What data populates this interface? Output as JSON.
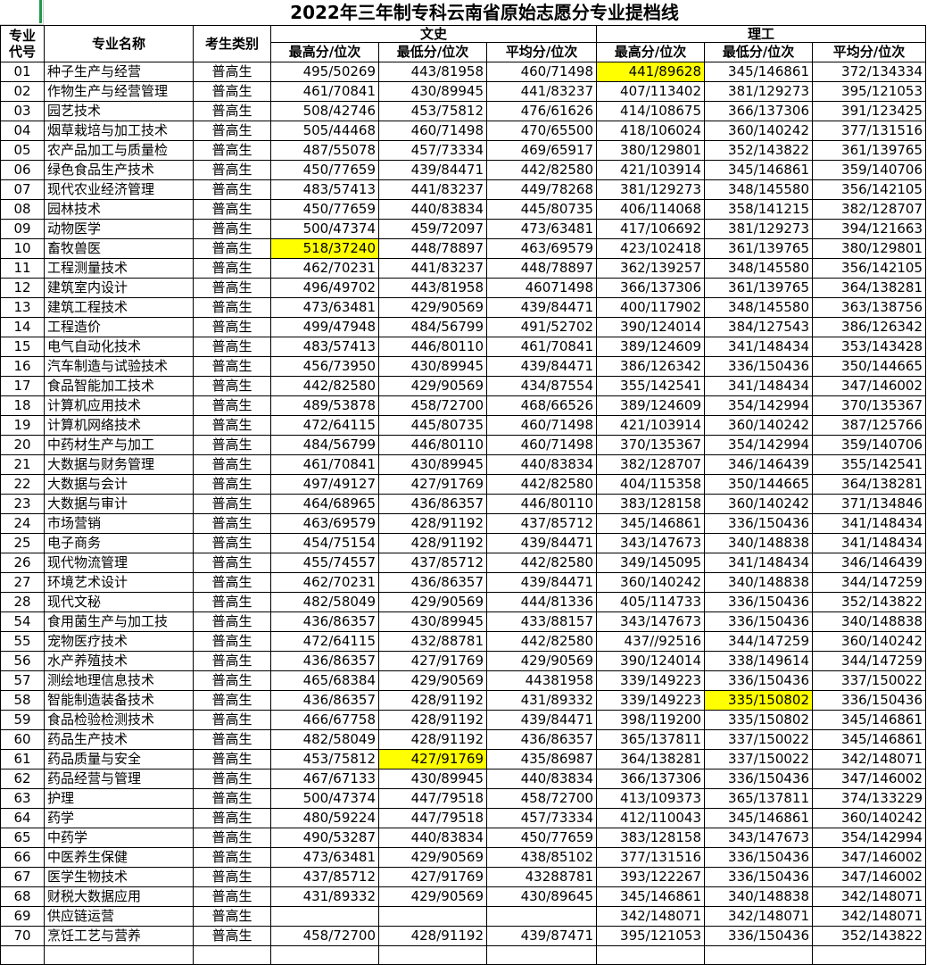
{
  "title": "2022年三年制专科云南省原始志愿分专业提档线",
  "headers": {
    "code": "专业代号",
    "name": "专业名称",
    "type": "考生类别",
    "wenshi": "文史",
    "ligong": "理工",
    "max": "最高分/位次",
    "min": "最低分/位次",
    "avg": "平均分/位次"
  },
  "highlight_color": "#ffff00",
  "rows": [
    {
      "code": "01",
      "name": "种子生产与经营",
      "type": "普高生",
      "w_max": "495/50269",
      "w_min": "443/81958",
      "w_avg": "460/71498",
      "l_max": "441/89628",
      "l_min": "345/146861",
      "l_avg": "372/134334",
      "hl": [
        "l_max"
      ]
    },
    {
      "code": "02",
      "name": "作物生产与经营管理",
      "type": "普高生",
      "w_max": "461/70841",
      "w_min": "430/89945",
      "w_avg": "441/83237",
      "l_max": "407/113402",
      "l_min": "381/129273",
      "l_avg": "395/121053",
      "hl": []
    },
    {
      "code": "03",
      "name": "园艺技术",
      "type": "普高生",
      "w_max": "508/42746",
      "w_min": "453/75812",
      "w_avg": "476/61626",
      "l_max": "414/108675",
      "l_min": "366/137306",
      "l_avg": "391/123425",
      "hl": []
    },
    {
      "code": "04",
      "name": "烟草栽培与加工技术",
      "type": "普高生",
      "w_max": "505/44468",
      "w_min": "460/71498",
      "w_avg": "470/65500",
      "l_max": "418/106024",
      "l_min": "360/140242",
      "l_avg": "377/131516",
      "hl": []
    },
    {
      "code": "05",
      "name": "农产品加工与质量检",
      "type": "普高生",
      "w_max": "487/55078",
      "w_min": "457/73334",
      "w_avg": "469/65917",
      "l_max": "380/129801",
      "l_min": "352/143822",
      "l_avg": "361/139765",
      "hl": []
    },
    {
      "code": "06",
      "name": "绿色食品生产技术",
      "type": "普高生",
      "w_max": "450/77659",
      "w_min": "439/84471",
      "w_avg": "442/82580",
      "l_max": "421/103914",
      "l_min": "345/146861",
      "l_avg": "359/140706",
      "hl": []
    },
    {
      "code": "07",
      "name": "现代农业经济管理",
      "type": "普高生",
      "w_max": "483/57413",
      "w_min": "441/83237",
      "w_avg": "449/78268",
      "l_max": "381/129273",
      "l_min": "348/145580",
      "l_avg": "356/142105",
      "hl": []
    },
    {
      "code": "08",
      "name": "园林技术",
      "type": "普高生",
      "w_max": "450/77659",
      "w_min": "440/83834",
      "w_avg": "445/80735",
      "l_max": "406/114068",
      "l_min": "358/141215",
      "l_avg": "382/128707",
      "hl": []
    },
    {
      "code": "09",
      "name": "动物医学",
      "type": "普高生",
      "w_max": "500/47374",
      "w_min": "459/72097",
      "w_avg": "473/63481",
      "l_max": "417/106692",
      "l_min": "381/129273",
      "l_avg": "394/121663",
      "hl": []
    },
    {
      "code": "10",
      "name": "畜牧兽医",
      "type": "普高生",
      "w_max": "518/37240",
      "w_min": "448/78897",
      "w_avg": "463/69579",
      "l_max": "423/102418",
      "l_min": "361/139765",
      "l_avg": "380/129801",
      "hl": [
        "w_max"
      ]
    },
    {
      "code": "11",
      "name": "工程测量技术",
      "type": "普高生",
      "w_max": "462/70231",
      "w_min": "441/83237",
      "w_avg": "448/78897",
      "l_max": "362/139257",
      "l_min": "348/145580",
      "l_avg": "356/142105",
      "hl": []
    },
    {
      "code": "12",
      "name": "建筑室内设计",
      "type": "普高生",
      "w_max": "496/49702",
      "w_min": "443/81958",
      "w_avg": "46071498",
      "l_max": "366/137306",
      "l_min": "361/139765",
      "l_avg": "364/138281",
      "hl": []
    },
    {
      "code": "13",
      "name": "建筑工程技术",
      "type": "普高生",
      "w_max": "473/63481",
      "w_min": "429/90569",
      "w_avg": "439/84471",
      "l_max": "400/117902",
      "l_min": "348/145580",
      "l_avg": "363/138756",
      "hl": []
    },
    {
      "code": "14",
      "name": "工程造价",
      "type": "普高生",
      "w_max": "499/47948",
      "w_min": "484/56799",
      "w_avg": "491/52702",
      "l_max": "390/124014",
      "l_min": "384/127543",
      "l_avg": "386/126342",
      "hl": []
    },
    {
      "code": "15",
      "name": "电气自动化技术",
      "type": "普高生",
      "w_max": "483/57413",
      "w_min": "446/80110",
      "w_avg": "461/70841",
      "l_max": "389/124609",
      "l_min": "341/148434",
      "l_avg": "353/143428",
      "hl": []
    },
    {
      "code": "16",
      "name": "汽车制造与试验技术",
      "type": "普高生",
      "w_max": "456/73950",
      "w_min": "430/89945",
      "w_avg": "439/84471",
      "l_max": "386/126342",
      "l_min": "336/150436",
      "l_avg": "350/144665",
      "hl": []
    },
    {
      "code": "17",
      "name": "食品智能加工技术",
      "type": "普高生",
      "w_max": "442/82580",
      "w_min": "429/90569",
      "w_avg": "434/87554",
      "l_max": "355/142541",
      "l_min": "341/148434",
      "l_avg": "347/146002",
      "hl": []
    },
    {
      "code": "18",
      "name": "计算机应用技术",
      "type": "普高生",
      "w_max": "489/53878",
      "w_min": "458/72700",
      "w_avg": "468/66526",
      "l_max": "389/124609",
      "l_min": "354/142994",
      "l_avg": "370/135367",
      "hl": []
    },
    {
      "code": "19",
      "name": "计算机网络技术",
      "type": "普高生",
      "w_max": "472/64115",
      "w_min": "445/80735",
      "w_avg": "460/71498",
      "l_max": "421/103914",
      "l_min": "360/140242",
      "l_avg": "387/125766",
      "hl": []
    },
    {
      "code": "20",
      "name": "中药材生产与加工",
      "type": "普高生",
      "w_max": "484/56799",
      "w_min": "446/80110",
      "w_avg": "460/71498",
      "l_max": "370/135367",
      "l_min": "354/142994",
      "l_avg": "359/140706",
      "hl": []
    },
    {
      "code": "21",
      "name": "大数据与财务管理",
      "type": "普高生",
      "w_max": "461/70841",
      "w_min": "430/89945",
      "w_avg": "440/83834",
      "l_max": "382/128707",
      "l_min": "346/146439",
      "l_avg": "355/142541",
      "hl": []
    },
    {
      "code": "22",
      "name": "大数据与会计",
      "type": "普高生",
      "w_max": "497/49127",
      "w_min": "427/91769",
      "w_avg": "442/82580",
      "l_max": "404/115358",
      "l_min": "350/144665",
      "l_avg": "364/138281",
      "hl": []
    },
    {
      "code": "23",
      "name": "大数据与审计",
      "type": "普高生",
      "w_max": "464/68965",
      "w_min": "436/86357",
      "w_avg": "446/80110",
      "l_max": "383/128158",
      "l_min": "360/140242",
      "l_avg": "371/134846",
      "hl": []
    },
    {
      "code": "24",
      "name": "市场营销",
      "type": "普高生",
      "w_max": "463/69579",
      "w_min": "428/91192",
      "w_avg": "437/85712",
      "l_max": "345/146861",
      "l_min": "336/150436",
      "l_avg": "341/148434",
      "hl": []
    },
    {
      "code": "25",
      "name": "电子商务",
      "type": "普高生",
      "w_max": "454/75154",
      "w_min": "428/91192",
      "w_avg": "439/84471",
      "l_max": "343/147673",
      "l_min": "340/148838",
      "l_avg": "341/148434",
      "hl": []
    },
    {
      "code": "26",
      "name": "现代物流管理",
      "type": "普高生",
      "w_max": "455/74557",
      "w_min": "437/85712",
      "w_avg": "442/82580",
      "l_max": "349/145095",
      "l_min": "341/148434",
      "l_avg": "346/146439",
      "hl": []
    },
    {
      "code": "27",
      "name": "环境艺术设计",
      "type": "普高生",
      "w_max": "462/70231",
      "w_min": "436/86357",
      "w_avg": "439/84471",
      "l_max": "360/140242",
      "l_min": "340/148838",
      "l_avg": "344/147259",
      "hl": []
    },
    {
      "code": "28",
      "name": "现代文秘",
      "type": "普高生",
      "w_max": "482/58049",
      "w_min": "429/90569",
      "w_avg": "444/81336",
      "l_max": "405/114733",
      "l_min": "336/150436",
      "l_avg": "352/143822",
      "hl": []
    },
    {
      "code": "54",
      "name": "食用菌生产与加工技",
      "type": "普高生",
      "w_max": "436/86357",
      "w_min": "430/89945",
      "w_avg": "433/88157",
      "l_max": "343/147673",
      "l_min": "336/150436",
      "l_avg": "340/148838",
      "hl": []
    },
    {
      "code": "55",
      "name": "宠物医疗技术",
      "type": "普高生",
      "w_max": "472/64115",
      "w_min": "432/88781",
      "w_avg": "442/82580",
      "l_max": "437//92516",
      "l_min": "344/147259",
      "l_avg": "360/140242",
      "hl": []
    },
    {
      "code": "56",
      "name": "水产养殖技术",
      "type": "普高生",
      "w_max": "436/86357",
      "w_min": "427/91769",
      "w_avg": "429/90569",
      "l_max": "390/124014",
      "l_min": "338/149614",
      "l_avg": "344/147259",
      "hl": []
    },
    {
      "code": "57",
      "name": "测绘地理信息技术",
      "type": "普高生",
      "w_max": "465/68384",
      "w_min": "429/90569",
      "w_avg": "44381958",
      "l_max": "339/149223",
      "l_min": "336/150436",
      "l_avg": "337/150022",
      "hl": []
    },
    {
      "code": "58",
      "name": "智能制造装备技术",
      "type": "普高生",
      "w_max": "436/86357",
      "w_min": "428/91192",
      "w_avg": "431/89332",
      "l_max": "339/149223",
      "l_min": "335/150802",
      "l_avg": "336/150436",
      "hl": [
        "l_min"
      ]
    },
    {
      "code": "59",
      "name": "食品检验检测技术",
      "type": "普高生",
      "w_max": "466/67758",
      "w_min": "428/91192",
      "w_avg": "439/84471",
      "l_max": "398/119200",
      "l_min": "335/150802",
      "l_avg": "345/146861",
      "hl": []
    },
    {
      "code": "60",
      "name": "药品生产技术",
      "type": "普高生",
      "w_max": "482/58049",
      "w_min": "428/91192",
      "w_avg": "436/86357",
      "l_max": "365/137811",
      "l_min": "337/150022",
      "l_avg": "345/146861",
      "hl": []
    },
    {
      "code": "61",
      "name": "药品质量与安全",
      "type": "普高生",
      "w_max": "453/75812",
      "w_min": "427/91769",
      "w_avg": "435/86987",
      "l_max": "364/138281",
      "l_min": "337/150022",
      "l_avg": "342/148071",
      "hl": [
        "w_min"
      ]
    },
    {
      "code": "62",
      "name": "药品经营与管理",
      "type": "普高生",
      "w_max": "467/67133",
      "w_min": "430/89945",
      "w_avg": "440/83834",
      "l_max": "366/137306",
      "l_min": "336/150436",
      "l_avg": "347/146002",
      "hl": []
    },
    {
      "code": "63",
      "name": "护理",
      "type": "普高生",
      "w_max": "500/47374",
      "w_min": "447/79518",
      "w_avg": "458/72700",
      "l_max": "413/109373",
      "l_min": "365/137811",
      "l_avg": "374/133229",
      "hl": []
    },
    {
      "code": "64",
      "name": "药学",
      "type": "普高生",
      "w_max": "480/59224",
      "w_min": "447/79518",
      "w_avg": "457/73334",
      "l_max": "412/110043",
      "l_min": "345/146861",
      "l_avg": "360/140242",
      "hl": []
    },
    {
      "code": "65",
      "name": "中药学",
      "type": "普高生",
      "w_max": "490/53287",
      "w_min": "440/83834",
      "w_avg": "450/77659",
      "l_max": "383/128158",
      "l_min": "343/147673",
      "l_avg": "354/142994",
      "hl": []
    },
    {
      "code": "66",
      "name": "中医养生保健",
      "type": "普高生",
      "w_max": "473/63481",
      "w_min": "429/90569",
      "w_avg": "438/85102",
      "l_max": "377/131516",
      "l_min": "336/150436",
      "l_avg": "347/146002",
      "hl": []
    },
    {
      "code": "67",
      "name": "医学生物技术",
      "type": "普高生",
      "w_max": "437/85712",
      "w_min": "427/91769",
      "w_avg": "43288781",
      "l_max": "393/122267",
      "l_min": "336/150436",
      "l_avg": "347/146002",
      "hl": []
    },
    {
      "code": "68",
      "name": "财税大数据应用",
      "type": "普高生",
      "w_max": "431/89332",
      "w_min": "429/90569",
      "w_avg": "430/89645",
      "l_max": "345/146861",
      "l_min": "340/148838",
      "l_avg": "342/148071",
      "hl": []
    },
    {
      "code": "69",
      "name": "供应链运营",
      "type": "普高生",
      "w_max": "",
      "w_min": "",
      "w_avg": "",
      "l_max": "342/148071",
      "l_min": "342/148071",
      "l_avg": "342/148071",
      "hl": []
    },
    {
      "code": "70",
      "name": "烹饪工艺与营养",
      "type": "普高生",
      "w_max": "458/72700",
      "w_min": "428/91192",
      "w_avg": "439/87471",
      "l_max": "395/121053",
      "l_min": "336/150436",
      "l_avg": "352/143822",
      "hl": []
    }
  ]
}
